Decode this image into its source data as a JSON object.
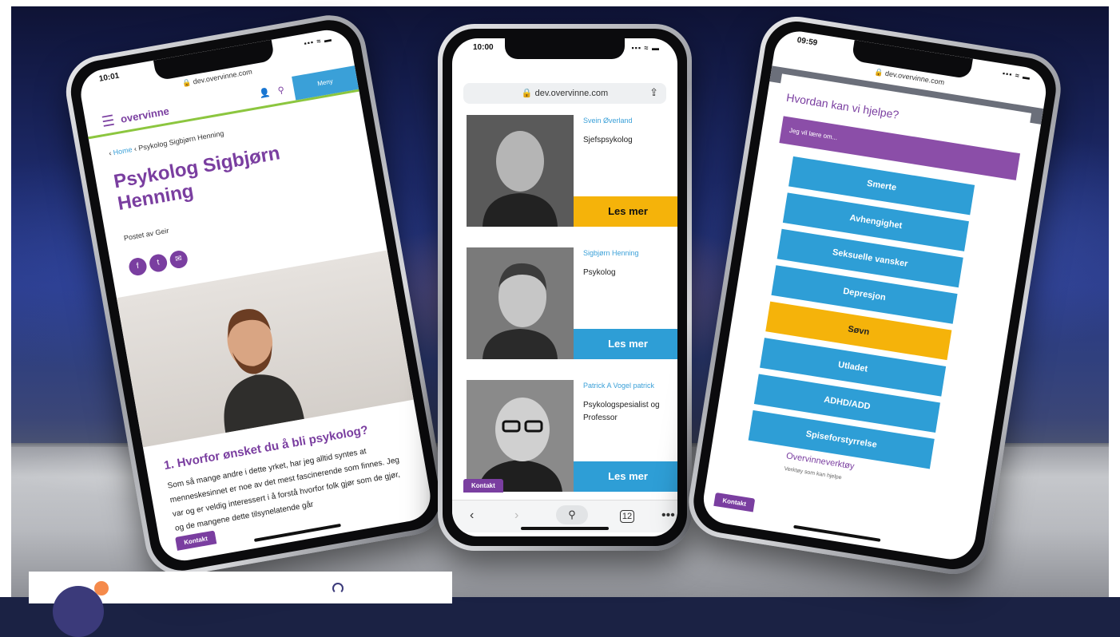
{
  "phone_left": {
    "time": "10:01",
    "status_icons": "▪▪▪ ≈ ▬",
    "url": "dev.overvinne.com",
    "logo": "overvinne",
    "menu_icon": "hamburger-icon",
    "nav_cta": "Meny",
    "breadcrumb_home": "Home",
    "breadcrumb_current": "Psykolog Sigbjørn Henning",
    "title": "Psykolog Sigbjørn Henning",
    "posted_by": "Postet av Geir",
    "question": "1. Hvorfor ønsket du å bli psykolog?",
    "body": "Som så mange andre i dette yrket, har jeg alltid syntes at menneskesinnet er noe av det mest fascinerende som finnes. Jeg var og er veldig interessert i å forstå hvorfor folk gjør som de gjør, og de mangene dette tilsynelatende går",
    "kontakt": "Kontakt"
  },
  "phone_middle": {
    "time": "10:00",
    "status_icons": "▪▪▪ ≈ ▬",
    "url": "dev.overvinne.com",
    "profiles": [
      {
        "name": "Svein Øverland",
        "role": "Sjefspsykolog",
        "button": "Les mer",
        "button_color": "#f5b30a"
      },
      {
        "name": "Sigbjørn Henning",
        "role": "Psykolog",
        "button": "Les mer",
        "button_color": "#2e9ed6"
      },
      {
        "name": "Patrick A Vogel patrick",
        "role": "Psykologspesialist og Professor",
        "button": "Les mer",
        "button_color": "#2e9ed6"
      }
    ],
    "kontakt": "Kontakt",
    "toolbar": {
      "back": "‹",
      "forward": "›",
      "search": "⚲",
      "tabs": "12",
      "menu": "•••"
    }
  },
  "phone_right": {
    "time": "09:59",
    "status_icons": "▪▪▪ ≈ ▬",
    "url": "dev.overvinne.com",
    "help_title": "Hvordan kan vi hjelpe?",
    "learn_placeholder": "Jeg vil lære om...",
    "topics": [
      "Smerte",
      "Avhengighet",
      "Seksuelle vansker",
      "Depresjon",
      "Søvn",
      "Utladet",
      "ADHD/ADD",
      "Spiseforstyrrelse"
    ],
    "active_topic": "Søvn",
    "tools_title": "Overvinneverktøy",
    "tools_sub": "Verktøy som kan hjelpe",
    "kontakt": "Kontakt"
  },
  "colors": {
    "brand_purple": "#7a3ea0",
    "accent_blue": "#2e9ed6",
    "accent_yellow": "#f5b30a"
  }
}
